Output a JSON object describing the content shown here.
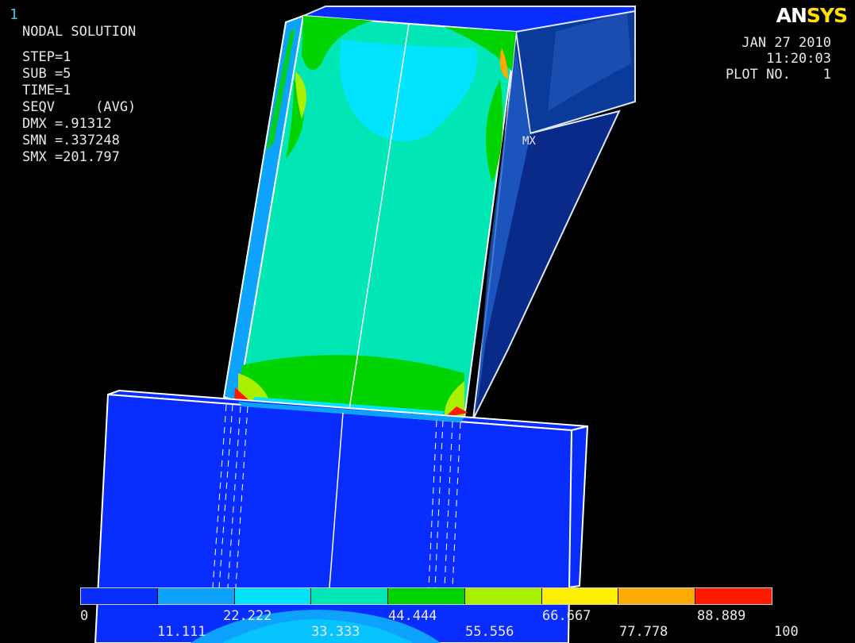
{
  "window_number": "1",
  "plot_title": "NODAL SOLUTION",
  "solution_info": [
    "STEP=1",
    "SUB =5",
    "TIME=1",
    "SEQV     (AVG)",
    "DMX =.91312",
    "SMN =.337248",
    "SMX =201.797"
  ],
  "logo": {
    "part1": "AN",
    "part2": "SYS"
  },
  "date": "JAN 27 2010",
  "time": "11:20:03",
  "plot_no": "PLOT NO.    1",
  "max_marker": "MX",
  "legend": {
    "colors": [
      "#0a2dff",
      "#0ea2ff",
      "#00e4ff",
      "#00e6b4",
      "#00d400",
      "#a8ef00",
      "#ffef00",
      "#ffaa00",
      "#ff1a00"
    ],
    "top_labels": [
      "0",
      "22.222",
      "44.444",
      "66.667",
      "88.889"
    ],
    "bottom_labels": [
      "11.111",
      "33.333",
      "55.556",
      "77.778",
      "100"
    ]
  }
}
